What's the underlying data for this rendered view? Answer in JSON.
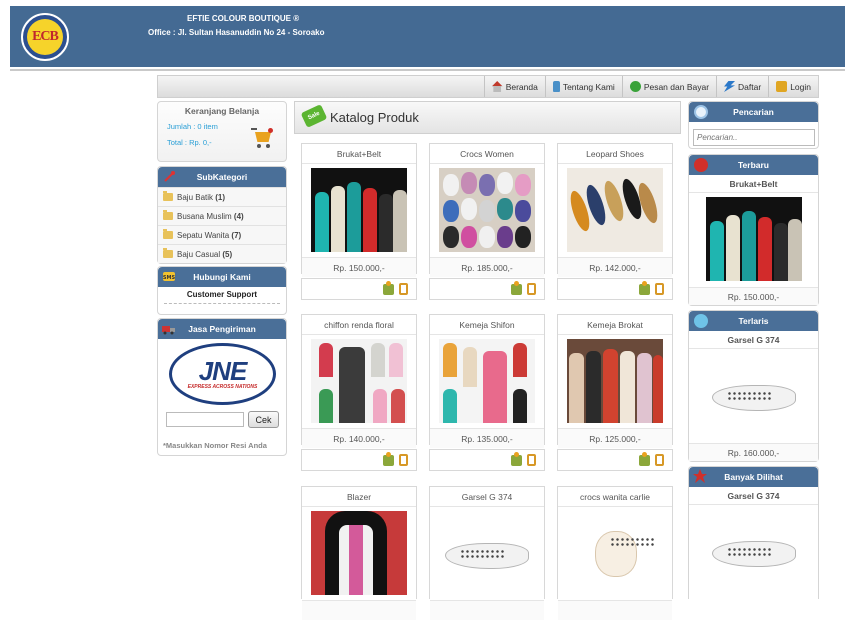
{
  "header": {
    "logo_text": "ECB",
    "site_title": "EFTIE COLOUR BOUTIQUE ®",
    "office": "Office : Jl. Sultan Hasanuddin No 24 - Soroako"
  },
  "nav": {
    "items": [
      {
        "label": "Beranda",
        "icon": "home-icon"
      },
      {
        "label": "Tentang Kami",
        "icon": "bottle-icon"
      },
      {
        "label": "Pesan dan Bayar",
        "icon": "cart-circle-icon"
      },
      {
        "label": "Daftar",
        "icon": "register-arrow-icon"
      },
      {
        "label": "Login",
        "icon": "lock-icon"
      }
    ]
  },
  "cart": {
    "title": "Keranjang Belanja",
    "jumlah": "Jumlah : 0 item",
    "total": "Total : Rp. 0,-"
  },
  "subkategori": {
    "title": "SubKategori",
    "items": [
      {
        "label": "Baju Batik",
        "count": "(1)"
      },
      {
        "label": "Busana Muslim",
        "count": "(4)"
      },
      {
        "label": "Sepatu Wanita",
        "count": "(7)"
      },
      {
        "label": "Baju Casual",
        "count": "(5)"
      }
    ]
  },
  "contact": {
    "title": "Hubungi Kami",
    "subtitle": "Customer Support"
  },
  "shipping": {
    "title": "Jasa Pengiriman",
    "logo_word": "JNE",
    "logo_tag": "EXPRESS ACROSS NATIONS",
    "button": "Cek",
    "note": "*Masukkan Nomor Resi Anda"
  },
  "catalog": {
    "badge": "Sale",
    "title": "Katalog Produk",
    "products": [
      {
        "name": "Brukat+Belt",
        "price": "Rp. 150.000,-"
      },
      {
        "name": "Crocs Women",
        "price": "Rp. 185.000,-"
      },
      {
        "name": "Leopard Shoes",
        "price": "Rp. 142.000,-"
      },
      {
        "name": "chiffon renda floral",
        "price": "Rp. 140.000,-"
      },
      {
        "name": "Kemeja Shifon",
        "price": "Rp. 135.000,-"
      },
      {
        "name": "Kemeja Brokat",
        "price": "Rp. 125.000,-"
      },
      {
        "name": "Blazer",
        "price": ""
      },
      {
        "name": "Garsel G 374",
        "price": ""
      },
      {
        "name": "crocs wanita carlie",
        "price": ""
      }
    ]
  },
  "sidebar_right": {
    "search_title": "Pencarian",
    "search_placeholder": "Pencarian..",
    "newest_title": "Terbaru",
    "newest_name": "Brukat+Belt",
    "newest_price": "Rp. 150.000,-",
    "best_title": "Terlaris",
    "best_name": "Garsel G 374",
    "best_price": "Rp. 160.000,-",
    "most_viewed_title": "Banyak Dilihat",
    "most_viewed_name": "Garsel G 374"
  }
}
